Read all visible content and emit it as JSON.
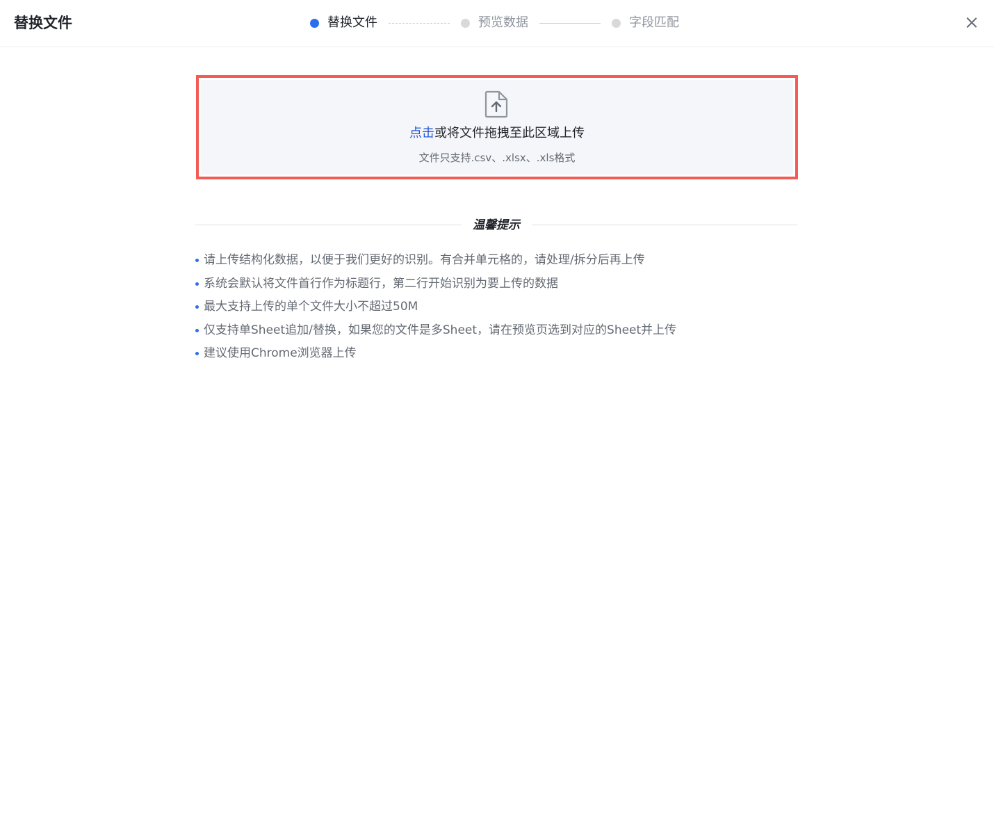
{
  "dialog": {
    "title": "替换文件"
  },
  "steps": [
    {
      "label": "替换文件",
      "active": true
    },
    {
      "label": "预览数据",
      "active": false
    },
    {
      "label": "字段匹配",
      "active": false
    }
  ],
  "upload": {
    "icon": "file-upload-icon",
    "link_text": "点击",
    "main_text": "或将文件拖拽至此区域上传",
    "hint": "文件只支持.csv、.xlsx、.xls格式"
  },
  "tips": {
    "title": "温馨提示",
    "items": [
      "请上传结构化数据，以便于我们更好的识别。有合并单元格的，请处理/拆分后再上传",
      "系统会默认将文件首行作为标题行，第二行开始识别为要上传的数据",
      "最大支持上传的单个文件大小不超过50M",
      "仅支持单Sheet追加/替换，如果您的文件是多Sheet，请在预览页选到对应的Sheet并上传",
      "建议使用Chrome浏览器上传"
    ]
  },
  "colors": {
    "accent": "#2b6ff0",
    "link": "#2558d6",
    "highlight_border": "#f25c54",
    "upload_bg": "#f5f6fa"
  }
}
